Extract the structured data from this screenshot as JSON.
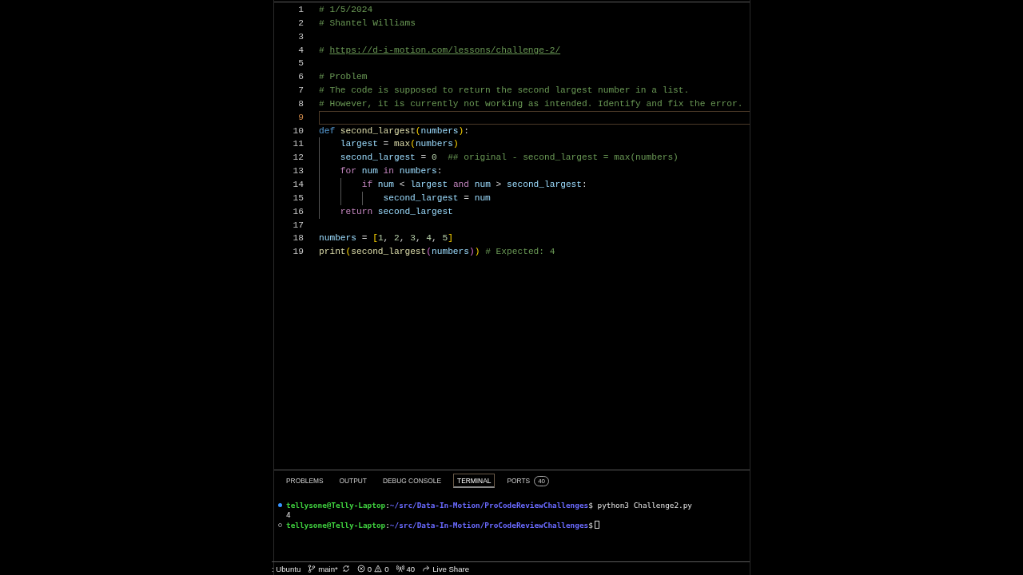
{
  "editor": {
    "lines": [
      {
        "number": "1",
        "current": false,
        "tokens": [
          {
            "kind": "comment",
            "text": "# 1/5/2024"
          }
        ]
      },
      {
        "number": "2",
        "current": false,
        "tokens": [
          {
            "kind": "comment",
            "text": "# Shantel Williams"
          }
        ]
      },
      {
        "number": "3",
        "current": false
      },
      {
        "number": "4",
        "current": false,
        "tokens": [
          {
            "kind": "comment",
            "text": "# "
          },
          {
            "kind": "link",
            "text": "https://d-i-motion.com/lessons/challenge-2/"
          }
        ]
      },
      {
        "number": "5",
        "current": false
      },
      {
        "number": "6",
        "current": false,
        "tokens": [
          {
            "kind": "comment",
            "text": "# Problem"
          }
        ]
      },
      {
        "number": "7",
        "current": false,
        "tokens": [
          {
            "kind": "comment",
            "text": "# The code is supposed to return the second largest number in a list."
          }
        ]
      },
      {
        "number": "8",
        "current": false,
        "tokens": [
          {
            "kind": "comment",
            "text": "# However, it is currently not working as intended. Identify and fix the error."
          }
        ]
      },
      {
        "number": "9",
        "current": true
      },
      {
        "number": "10",
        "current": false,
        "tokens": [
          {
            "kind": "keyword",
            "text": "def "
          },
          {
            "kind": "function",
            "text": "second_largest"
          },
          {
            "kind": "bracket",
            "text": "("
          },
          {
            "kind": "variable",
            "text": "numbers"
          },
          {
            "kind": "bracket",
            "text": ")"
          },
          {
            "kind": "plain",
            "text": ":"
          }
        ],
        "children": [
          {
            "number": "11",
            "current": false,
            "tokens": [
              {
                "kind": "variable",
                "text": "largest"
              },
              {
                "kind": "plain",
                "text": " = "
              },
              {
                "kind": "function",
                "text": "max"
              },
              {
                "kind": "bracket",
                "text": "("
              },
              {
                "kind": "variable",
                "text": "numbers"
              },
              {
                "kind": "bracket",
                "text": ")"
              }
            ]
          },
          {
            "number": "12",
            "current": false,
            "tokens": [
              {
                "kind": "variable",
                "text": "second_largest"
              },
              {
                "kind": "plain",
                "text": " = "
              },
              {
                "kind": "number",
                "text": "0"
              },
              {
                "kind": "comment",
                "text": "  ## original - second_largest = max(numbers)"
              }
            ]
          },
          {
            "number": "13",
            "current": false,
            "tokens": [
              {
                "kind": "control",
                "text": "for "
              },
              {
                "kind": "variable",
                "text": "num "
              },
              {
                "kind": "control",
                "text": "in "
              },
              {
                "kind": "variable",
                "text": "numbers"
              },
              {
                "kind": "plain",
                "text": ":"
              }
            ],
            "children": [
              {
                "number": "14",
                "current": false,
                "tokens": [
                  {
                    "kind": "control",
                    "text": "if "
                  },
                  {
                    "kind": "variable",
                    "text": "num"
                  },
                  {
                    "kind": "plain",
                    "text": " < "
                  },
                  {
                    "kind": "variable",
                    "text": "largest "
                  },
                  {
                    "kind": "control",
                    "text": "and "
                  },
                  {
                    "kind": "variable",
                    "text": "num"
                  },
                  {
                    "kind": "plain",
                    "text": " > "
                  },
                  {
                    "kind": "variable",
                    "text": "second_largest"
                  },
                  {
                    "kind": "plain",
                    "text": ":"
                  }
                ],
                "children": [
                  {
                    "number": "15",
                    "current": false,
                    "tokens": [
                      {
                        "kind": "variable",
                        "text": "second_largest"
                      },
                      {
                        "kind": "plain",
                        "text": " = "
                      },
                      {
                        "kind": "variable",
                        "text": "num"
                      }
                    ]
                  }
                ]
              }
            ]
          },
          {
            "number": "16",
            "current": false,
            "tokens": [
              {
                "kind": "control",
                "text": "return "
              },
              {
                "kind": "variable",
                "text": "second_largest"
              }
            ]
          }
        ]
      },
      {
        "number": "17",
        "current": false
      },
      {
        "number": "18",
        "current": false,
        "tokens": [
          {
            "kind": "variable",
            "text": "numbers"
          },
          {
            "kind": "plain",
            "text": " = "
          },
          {
            "kind": "bracket",
            "text": "["
          },
          {
            "kind": "number",
            "text": "1"
          },
          {
            "kind": "plain",
            "text": ", "
          },
          {
            "kind": "number",
            "text": "2"
          },
          {
            "kind": "plain",
            "text": ", "
          },
          {
            "kind": "number",
            "text": "3"
          },
          {
            "kind": "plain",
            "text": ", "
          },
          {
            "kind": "number",
            "text": "4"
          },
          {
            "kind": "plain",
            "text": ", "
          },
          {
            "kind": "number",
            "text": "5"
          },
          {
            "kind": "bracket",
            "text": "]"
          }
        ]
      },
      {
        "number": "19",
        "current": false,
        "tokens": [
          {
            "kind": "function",
            "text": "print"
          },
          {
            "kind": "bracket",
            "text": "("
          },
          {
            "kind": "function",
            "text": "second_largest"
          },
          {
            "kind": "bracket2",
            "text": "("
          },
          {
            "kind": "variable",
            "text": "numbers"
          },
          {
            "kind": "bracket2",
            "text": ")"
          },
          {
            "kind": "bracket",
            "text": ")"
          },
          {
            "kind": "comment",
            "text": " # Expected: 4"
          }
        ]
      }
    ]
  },
  "panel": {
    "tabs": [
      {
        "label": "PROBLEMS",
        "selected": false
      },
      {
        "label": "OUTPUT",
        "selected": false
      },
      {
        "label": "DEBUG CONSOLE",
        "selected": false
      },
      {
        "label": "TERMINAL",
        "selected": true
      },
      {
        "label": "PORTS",
        "selected": false,
        "badge": "40"
      }
    ],
    "terminal": [
      {
        "kind": "prompt",
        "completed": true,
        "user": "tellysone@Telly-Laptop",
        "separator": ":",
        "path": "~/src/Data-In-Motion/ProCodeReviewChallenges",
        "dollar": "$",
        "command": "python3 Challenge2.py",
        "cursor": false
      },
      {
        "kind": "output",
        "text": "4"
      },
      {
        "kind": "prompt",
        "completed": false,
        "user": "tellysone@Telly-Laptop",
        "separator": ":",
        "path": "~/src/Data-In-Motion/ProCodeReviewChallenges",
        "dollar": "$",
        "cursor": true
      }
    ]
  },
  "status_bar": [
    {
      "kind": "remote",
      "text": ": Ubuntu"
    },
    {
      "kind": "branch",
      "text": "main*"
    },
    {
      "kind": "sync"
    },
    {
      "kind": "problems",
      "errors": "0",
      "warnings": "0"
    },
    {
      "kind": "ports",
      "text": "40"
    },
    {
      "kind": "liveshare",
      "text": "Live Share"
    }
  ]
}
